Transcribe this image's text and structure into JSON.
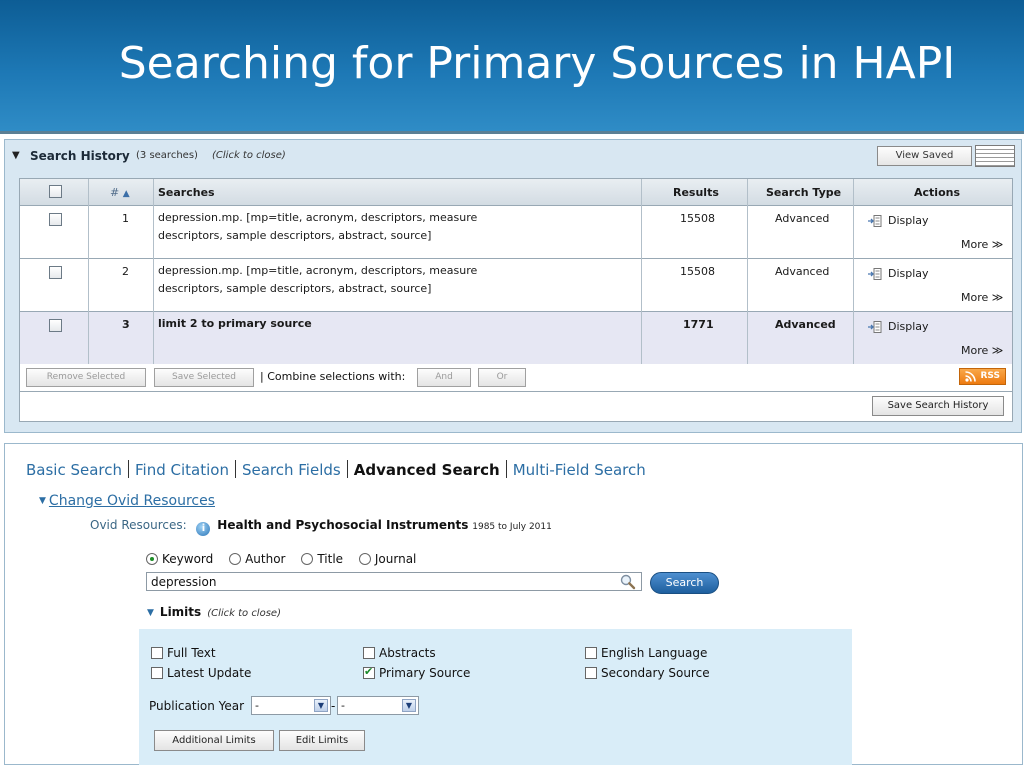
{
  "slide": {
    "title": "Searching for Primary Sources in HAPI"
  },
  "history": {
    "toggle_glyph": "▼",
    "title": "Search History",
    "count": "(3 searches)",
    "close_hint": "(Click to close)",
    "view_saved_label": "View Saved",
    "columns": {
      "number": "#",
      "sort_glyph": "▲",
      "searches": "Searches",
      "results": "Results",
      "search_type": "Search Type",
      "actions": "Actions"
    },
    "rows": [
      {
        "number": "1",
        "search_line1": "depression.mp. [mp=title, acronym, descriptors, measure",
        "search_line2": "descriptors, sample descriptors, abstract, source]",
        "results": "15508",
        "search_type": "Advanced",
        "display_label": "Display",
        "more_label": "More ≫"
      },
      {
        "number": "2",
        "search_line1": "depression.mp. [mp=title, acronym, descriptors, measure",
        "search_line2": "descriptors, sample descriptors, abstract, source]",
        "results": "15508",
        "search_type": "Advanced",
        "display_label": "Display",
        "more_label": "More ≫"
      },
      {
        "number": "3",
        "search_line1": "limit 2 to primary source",
        "search_line2": "",
        "results": "1771",
        "search_type": "Advanced",
        "display_label": "Display",
        "more_label": "More ≫"
      }
    ],
    "remove_selected_label": "Remove Selected",
    "save_selected_label": "Save Selected",
    "combine_label": "| Combine selections with:",
    "and_label": "And",
    "or_label": "Or",
    "rss_label": "RSS",
    "save_history_label": "Save Search History"
  },
  "search": {
    "tabs": [
      {
        "label": "Basic Search"
      },
      {
        "label": "Find Citation"
      },
      {
        "label": "Search Fields"
      },
      {
        "label": "Advanced Search"
      },
      {
        "label": "Multi-Field Search"
      }
    ],
    "change_resources_label": "Change Ovid Resources",
    "ovid_resources_label": "Ovid Resources:",
    "ovid_database": "Health and Psychosocial Instruments",
    "ovid_range": "1985 to July 2011",
    "info_glyph": "i",
    "radio_options": [
      {
        "label": "Keyword",
        "selected": true
      },
      {
        "label": "Author",
        "selected": false
      },
      {
        "label": "Title",
        "selected": false
      },
      {
        "label": "Journal",
        "selected": false
      }
    ],
    "query_value": "depression",
    "search_button_label": "Search",
    "limits_glyph": "▼",
    "limits_label": "Limits",
    "limits_hint": "(Click to close)",
    "limits": [
      {
        "label": "Full Text",
        "checked": false
      },
      {
        "label": "Abstracts",
        "checked": false
      },
      {
        "label": "English Language",
        "checked": false
      },
      {
        "label": "Latest Update",
        "checked": false
      },
      {
        "label": "Primary Source",
        "checked": true
      },
      {
        "label": "Secondary Source",
        "checked": false
      }
    ],
    "publication_year_label": "Publication Year",
    "year_from_value": "-",
    "year_to_value": "-",
    "year_dash": "-",
    "select_arrow_glyph": "▼",
    "additional_limits_label": "Additional Limits",
    "edit_limits_label": "Edit Limits"
  },
  "colors": {
    "header_blue": "#1d78b5",
    "link_blue": "#2c6ea4",
    "panel_bg": "#d8e7f2",
    "limits_bg": "#d9edf8",
    "highlight_row": "#e6e7f3",
    "rss_orange": "#ed7a10",
    "search_button_blue": "#1e5f9e"
  }
}
